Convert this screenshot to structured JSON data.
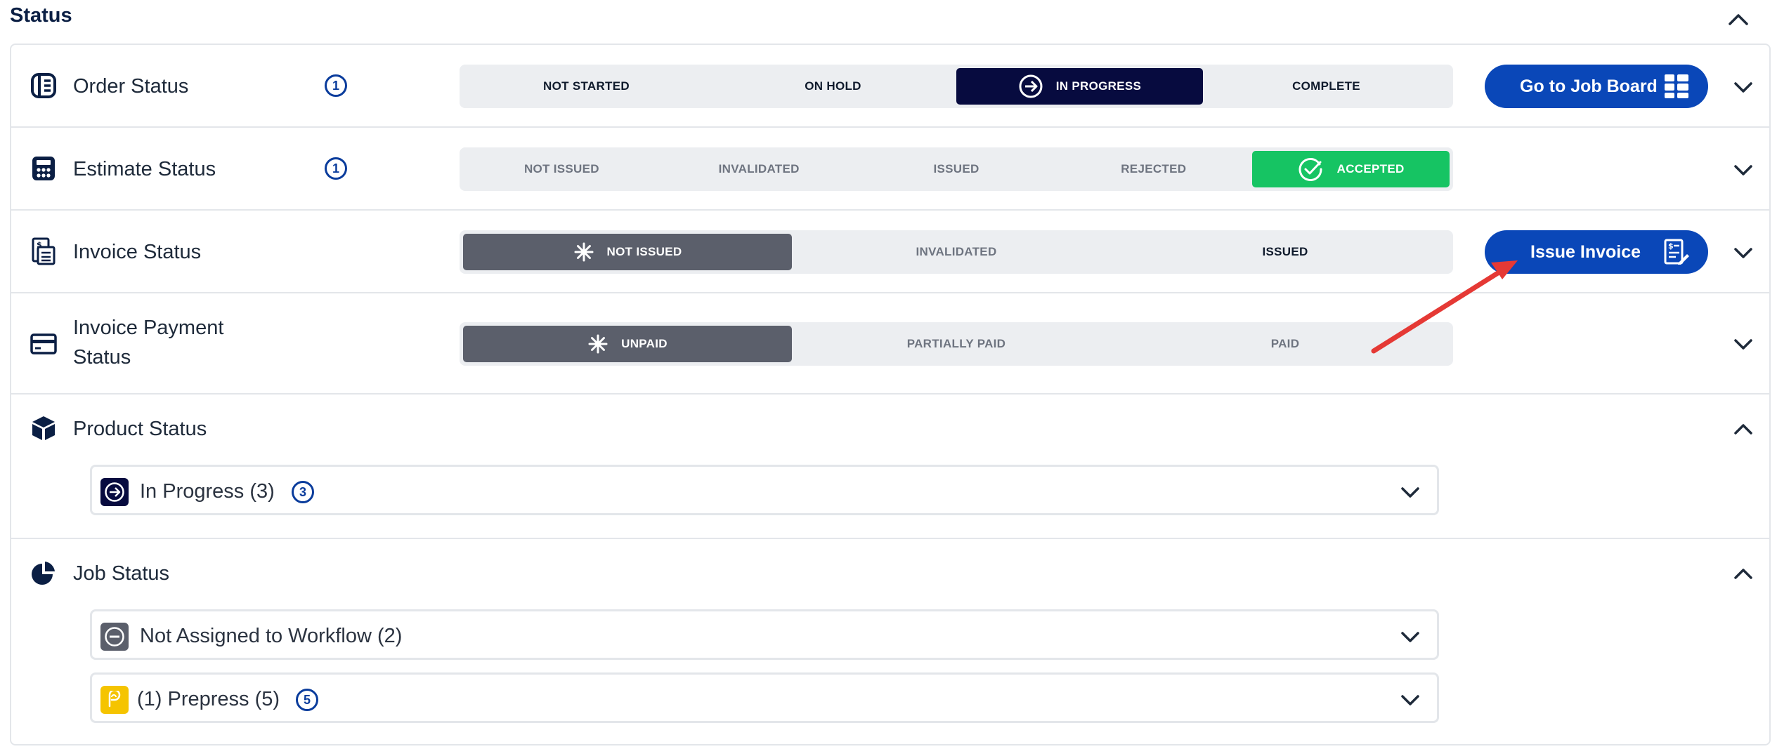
{
  "section": {
    "title": "Status"
  },
  "order_status": {
    "label": "Order Status",
    "count": "1",
    "options": [
      "NOT STARTED",
      "ON HOLD",
      "IN PROGRESS",
      "COMPLETE"
    ],
    "selected": "IN PROGRESS",
    "button_label": "Go to Job Board"
  },
  "estimate_status": {
    "label": "Estimate Status",
    "count": "1",
    "options": [
      "NOT ISSUED",
      "INVALIDATED",
      "ISSUED",
      "REJECTED",
      "ACCEPTED"
    ],
    "selected": "ACCEPTED"
  },
  "invoice_status": {
    "label": "Invoice Status",
    "options": [
      "NOT ISSUED",
      "INVALIDATED",
      "ISSUED"
    ],
    "selected": "NOT ISSUED",
    "button_label": "Issue Invoice"
  },
  "invoice_payment_status": {
    "label_line1": "Invoice Payment",
    "label_line2": "Status",
    "options": [
      "UNPAID",
      "PARTIALLY PAID",
      "PAID"
    ],
    "selected": "UNPAID"
  },
  "product_status": {
    "label": "Product Status",
    "items": [
      {
        "label": "In Progress (3)",
        "count": "3",
        "icon": "arrow-right-circle-icon"
      }
    ]
  },
  "job_status": {
    "label": "Job Status",
    "items": [
      {
        "label": "Not Assigned to Workflow (2)",
        "icon": "minus-circle-icon"
      },
      {
        "label": "(1) Prepress (5)",
        "count": "5",
        "icon": "prepress-icon"
      }
    ]
  },
  "colors": {
    "brand_blue": "#0a47b8",
    "navy": "#070b3f",
    "green": "#16c463",
    "grey": "#5b5f6b",
    "annotation_red": "#e53935",
    "prepress_yellow": "#f5c400"
  }
}
